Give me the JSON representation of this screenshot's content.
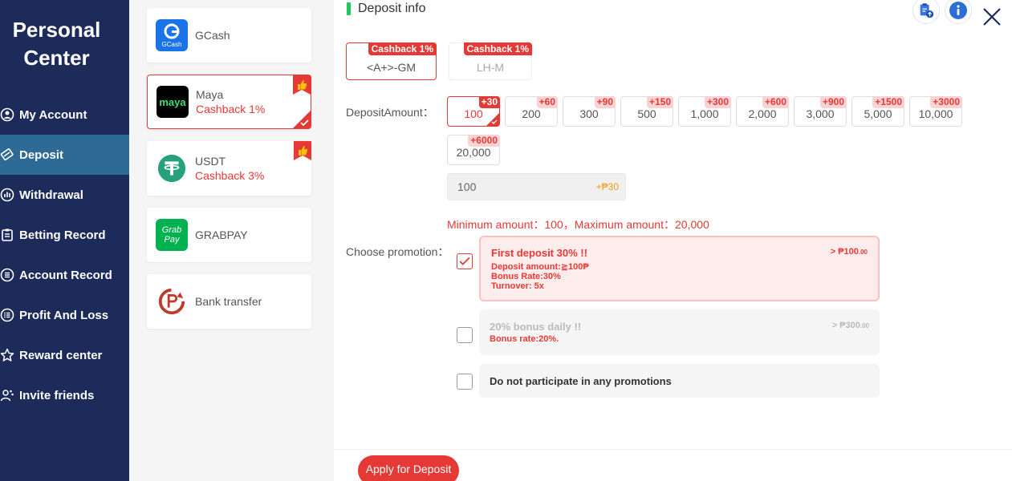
{
  "sidebar": {
    "title_line1": "Personal",
    "title_line2": "Center",
    "items": [
      {
        "label": "My Account",
        "icon": "user-circle-icon"
      },
      {
        "label": "Deposit",
        "icon": "deposit-card-icon",
        "active": true
      },
      {
        "label": "Withdrawal",
        "icon": "withdrawal-chart-icon"
      },
      {
        "label": "Betting Record",
        "icon": "clipboard-icon"
      },
      {
        "label": "Account Record",
        "icon": "list-icon"
      },
      {
        "label": "Profit And Loss",
        "icon": "profit-list-icon"
      },
      {
        "label": "Reward center",
        "icon": "star-icon"
      },
      {
        "label": "Invite friends",
        "icon": "invite-users-icon"
      }
    ]
  },
  "channels": [
    {
      "name": "GCash",
      "cashback": "",
      "logo": "gcash-logo",
      "logo_text": "GCash"
    },
    {
      "name": "Maya",
      "cashback": "Cashback 1%",
      "logo": "maya-logo",
      "logo_text": "maya",
      "selected": true,
      "recommended": true
    },
    {
      "name": "USDT",
      "cashback": "Cashback 3%",
      "logo": "usdt-logo",
      "recommended": true
    },
    {
      "name": "GRABPAY",
      "cashback": "",
      "logo": "grabpay-logo",
      "logo_text": "Grab Pay"
    },
    {
      "name": "Bank transfer",
      "cashback": "",
      "logo": "bank-transfer-logo"
    }
  ],
  "panel": {
    "title": "Deposit info",
    "accent": "#22c55e"
  },
  "gateways": [
    {
      "label": "<A+>-GM",
      "tag": "Cashback 1%",
      "selected": true
    },
    {
      "label": "LH-M",
      "tag": "Cashback 1%",
      "selected": false
    }
  ],
  "deposit_amount_label": "DepositAmount：",
  "amounts": [
    {
      "value": "100",
      "bonus": "+30",
      "selected": true
    },
    {
      "value": "200",
      "bonus": "+60"
    },
    {
      "value": "300",
      "bonus": "+90"
    },
    {
      "value": "500",
      "bonus": "+150"
    },
    {
      "value": "1,000",
      "bonus": "+300"
    },
    {
      "value": "2,000",
      "bonus": "+600"
    },
    {
      "value": "3,000",
      "bonus": "+900"
    },
    {
      "value": "5,000",
      "bonus": "+1500"
    },
    {
      "value": "10,000",
      "bonus": "+3000"
    },
    {
      "value": "20,000",
      "bonus": "+6000"
    }
  ],
  "amount_input": {
    "value": "100",
    "extra": "+₱30"
  },
  "limit_text": "Minimum amount：100，Maximum amount：20,000",
  "choose_promotion_label": "Choose promotion：",
  "promotions": [
    {
      "title": "First deposit 30% !!",
      "lines": [
        "Deposit amount:≧100₱",
        "Bonus Rate:30%",
        "Turnover: 5x"
      ],
      "right": "> ₱100",
      "right_cents": ".00",
      "checked": true
    },
    {
      "title": "20% bonus daily !!",
      "lines": [
        "Bonus rate:20%."
      ],
      "right": "> ₱300",
      "right_cents": ".00",
      "checked": false
    },
    {
      "title": "Do not participate in any promotions",
      "lines": [],
      "checked": false
    }
  ],
  "apply_button": "Apply for Deposit",
  "colors": {
    "sidebar_bg": "#1d2b5a",
    "sidebar_active": "#2d6a95",
    "brand_red": "#e53935"
  }
}
